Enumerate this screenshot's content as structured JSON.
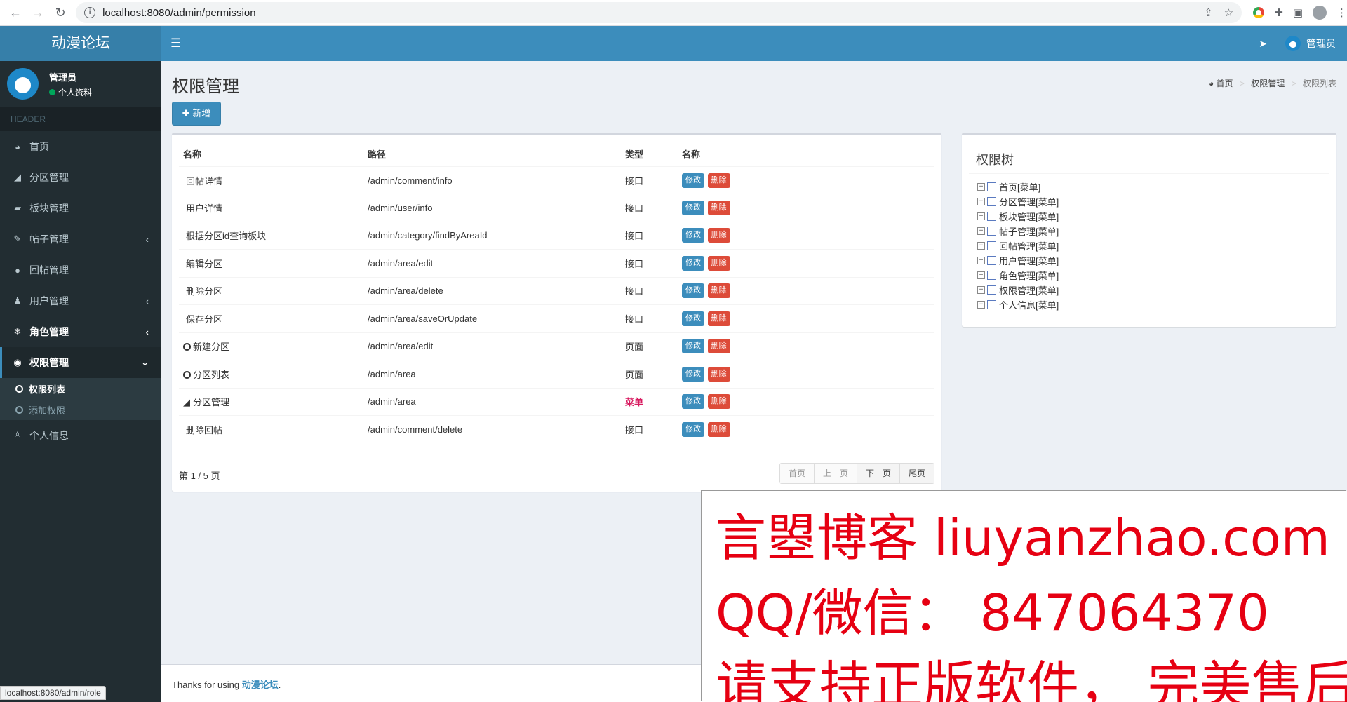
{
  "browser": {
    "url": "localhost:8080/admin/permission",
    "status_url": "localhost:8080/admin/role"
  },
  "header": {
    "logo": "动漫论坛",
    "user_name": "管理员"
  },
  "sidebar": {
    "user_name": "管理员",
    "user_status": "个人资料",
    "section_label": "HEADER",
    "items": [
      {
        "label": "首页",
        "icon": "dashboard-icon"
      },
      {
        "label": "分区管理",
        "icon": "area-chart-icon"
      },
      {
        "label": "板块管理",
        "icon": "book-icon"
      },
      {
        "label": "帖子管理",
        "icon": "brush-icon"
      },
      {
        "label": "回帖管理",
        "icon": "comments-icon"
      },
      {
        "label": "用户管理",
        "icon": "users-icon"
      },
      {
        "label": "角色管理",
        "icon": "snowflake-icon"
      },
      {
        "label": "权限管理",
        "icon": "map-pin-icon"
      },
      {
        "label": "个人信息",
        "icon": "user-icon"
      }
    ],
    "submenu": [
      "权限列表",
      "添加权限"
    ]
  },
  "page": {
    "title": "权限管理",
    "breadcrumb": [
      "首页",
      "权限管理",
      "权限列表"
    ],
    "add_button": "新增"
  },
  "table": {
    "headers": [
      "名称",
      "路径",
      "类型",
      "名称"
    ],
    "edit_label": "修改",
    "delete_label": "删除",
    "rows": [
      {
        "name": "回帖详情",
        "path": "/admin/comment/info",
        "type": "接口"
      },
      {
        "name": "用户详情",
        "path": "/admin/user/info",
        "type": "接口"
      },
      {
        "name": "根据分区id查询板块",
        "path": "/admin/category/findByAreaId",
        "type": "接口"
      },
      {
        "name": "编辑分区",
        "path": "/admin/area/edit",
        "type": "接口"
      },
      {
        "name": "删除分区",
        "path": "/admin/area/delete",
        "type": "接口"
      },
      {
        "name": "保存分区",
        "path": "/admin/area/saveOrUpdate",
        "type": "接口"
      },
      {
        "name": "新建分区",
        "path": "/admin/area/edit",
        "type": "页面"
      },
      {
        "name": "分区列表",
        "path": "/admin/area",
        "type": "页面"
      },
      {
        "name": "分区管理",
        "path": "/admin/area",
        "type": "菜单"
      },
      {
        "name": "删除回帖",
        "path": "/admin/comment/delete",
        "type": "接口"
      }
    ],
    "pager_text": "第 1 / 5 页",
    "pager": [
      "首页",
      "上一页",
      "下一页",
      "尾页"
    ]
  },
  "tree": {
    "title": "权限树",
    "items": [
      "首页[菜单]",
      "分区管理[菜单]",
      "板块管理[菜单]",
      "帖子管理[菜单]",
      "回帖管理[菜单]",
      "用户管理[菜单]",
      "角色管理[菜单]",
      "权限管理[菜单]",
      "个人信息[菜单]"
    ]
  },
  "footer": {
    "prefix": "Thanks for using",
    "brand": "动漫论坛",
    "suffix": "."
  },
  "watermark": {
    "line1": "言曌博客 liuyanzhao.com",
    "line2": "QQ/微信： 847064370",
    "line3": "请支持正版软件， 完美售后"
  },
  "colors": {
    "header": "#3c8dbc",
    "sidebar": "#222d32",
    "danger": "#dd4b39",
    "menu_type": "#d81b60"
  }
}
